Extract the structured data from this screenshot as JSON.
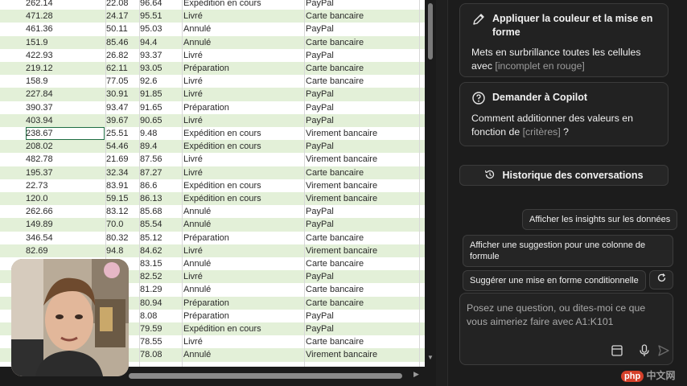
{
  "spreadsheet": {
    "selected_row": 10,
    "rows": [
      {
        "a": "262.14",
        "b": "22.08",
        "c": "96.64",
        "d": "Expédition en cours",
        "e": "PayPal"
      },
      {
        "a": "471.28",
        "b": "24.17",
        "c": "95.51",
        "d": "Livré",
        "e": "Carte bancaire"
      },
      {
        "a": "461.36",
        "b": "50.11",
        "c": "95.03",
        "d": "Annulé",
        "e": "PayPal"
      },
      {
        "a": "151.9",
        "b": "85.46",
        "c": "94.4",
        "d": "Annulé",
        "e": "Carte bancaire"
      },
      {
        "a": "422.93",
        "b": "26.82",
        "c": "93.37",
        "d": "Livré",
        "e": "PayPal"
      },
      {
        "a": "219.12",
        "b": "62.11",
        "c": "93.05",
        "d": "Préparation",
        "e": "Carte bancaire"
      },
      {
        "a": "158.9",
        "b": "77.05",
        "c": "92.6",
        "d": "Livré",
        "e": "Carte bancaire"
      },
      {
        "a": "227.84",
        "b": "30.91",
        "c": "91.85",
        "d": "Livré",
        "e": "PayPal"
      },
      {
        "a": "390.37",
        "b": "93.47",
        "c": "91.65",
        "d": "Préparation",
        "e": "PayPal"
      },
      {
        "a": "403.94",
        "b": "39.67",
        "c": "90.65",
        "d": "Livré",
        "e": "PayPal"
      },
      {
        "a": "238.67",
        "b": "25.51",
        "c": "9.48",
        "d": "Expédition en cours",
        "e": "Virement bancaire"
      },
      {
        "a": "208.02",
        "b": "54.46",
        "c": "89.4",
        "d": "Expédition en cours",
        "e": "PayPal"
      },
      {
        "a": "482.78",
        "b": "21.69",
        "c": "87.56",
        "d": "Livré",
        "e": "Virement bancaire"
      },
      {
        "a": "195.37",
        "b": "32.34",
        "c": "87.27",
        "d": "Livré",
        "e": "Carte bancaire"
      },
      {
        "a": "22.73",
        "b": "83.91",
        "c": "86.6",
        "d": "Expédition en cours",
        "e": "Virement bancaire"
      },
      {
        "a": "120.0",
        "b": "59.15",
        "c": "86.13",
        "d": "Expédition en cours",
        "e": "Virement bancaire"
      },
      {
        "a": "262.66",
        "b": "83.12",
        "c": "85.68",
        "d": "Annulé",
        "e": "PayPal"
      },
      {
        "a": "149.89",
        "b": "70.0",
        "c": "85.54",
        "d": "Annulé",
        "e": "PayPal"
      },
      {
        "a": "346.54",
        "b": "80.32",
        "c": "85.12",
        "d": "Préparation",
        "e": "Carte bancaire"
      },
      {
        "a": "82.69",
        "b": "94.8",
        "c": "84.62",
        "d": "Livré",
        "e": "Virement bancaire"
      },
      {
        "a": "",
        "b": "",
        "c": "83.15",
        "d": "Annulé",
        "e": "Carte bancaire"
      },
      {
        "a": "",
        "b": "",
        "c": "82.52",
        "d": "Livré",
        "e": "PayPal"
      },
      {
        "a": "",
        "b": "",
        "c": "81.29",
        "d": "Annulé",
        "e": "Carte bancaire"
      },
      {
        "a": "",
        "b": "",
        "c": "80.94",
        "d": "Préparation",
        "e": "Carte bancaire"
      },
      {
        "a": "",
        "b": "",
        "c": "8.08",
        "d": "Préparation",
        "e": "PayPal"
      },
      {
        "a": "",
        "b": "",
        "c": "79.59",
        "d": "Expédition en cours",
        "e": "PayPal"
      },
      {
        "a": "",
        "b": "",
        "c": "78.55",
        "d": "Livré",
        "e": "Carte bancaire"
      },
      {
        "a": "",
        "b": "",
        "c": "78.08",
        "d": "Annulé",
        "e": "Virement bancaire"
      }
    ]
  },
  "copilot": {
    "card1": {
      "title": "Appliquer la couleur et la mise en forme",
      "body_prefix": "Mets en surbrillance toutes les cellules avec",
      "body_placeholder": "[incomplet en rouge]"
    },
    "card2": {
      "title": "Demander à Copilot",
      "body_prefix": "Comment additionner des valeurs en fonction de",
      "body_placeholder": "[critères]",
      "body_suffix": "?"
    },
    "history_label": "Historique des conversations",
    "suggestions": [
      "Afficher les insights sur les données",
      "Afficher une suggestion pour une colonne de formule",
      "Suggérer une mise en forme conditionnelle"
    ],
    "composer_placeholder": "Posez une question, ou dites-moi ce que vous aimeriez faire avec A1:K101"
  },
  "watermark": {
    "logo": "php",
    "text": "中文网"
  },
  "colors": {
    "row_alt": "#e3f0d8",
    "panel_bg": "#1c1c1c",
    "selection": "#1f6e43"
  }
}
